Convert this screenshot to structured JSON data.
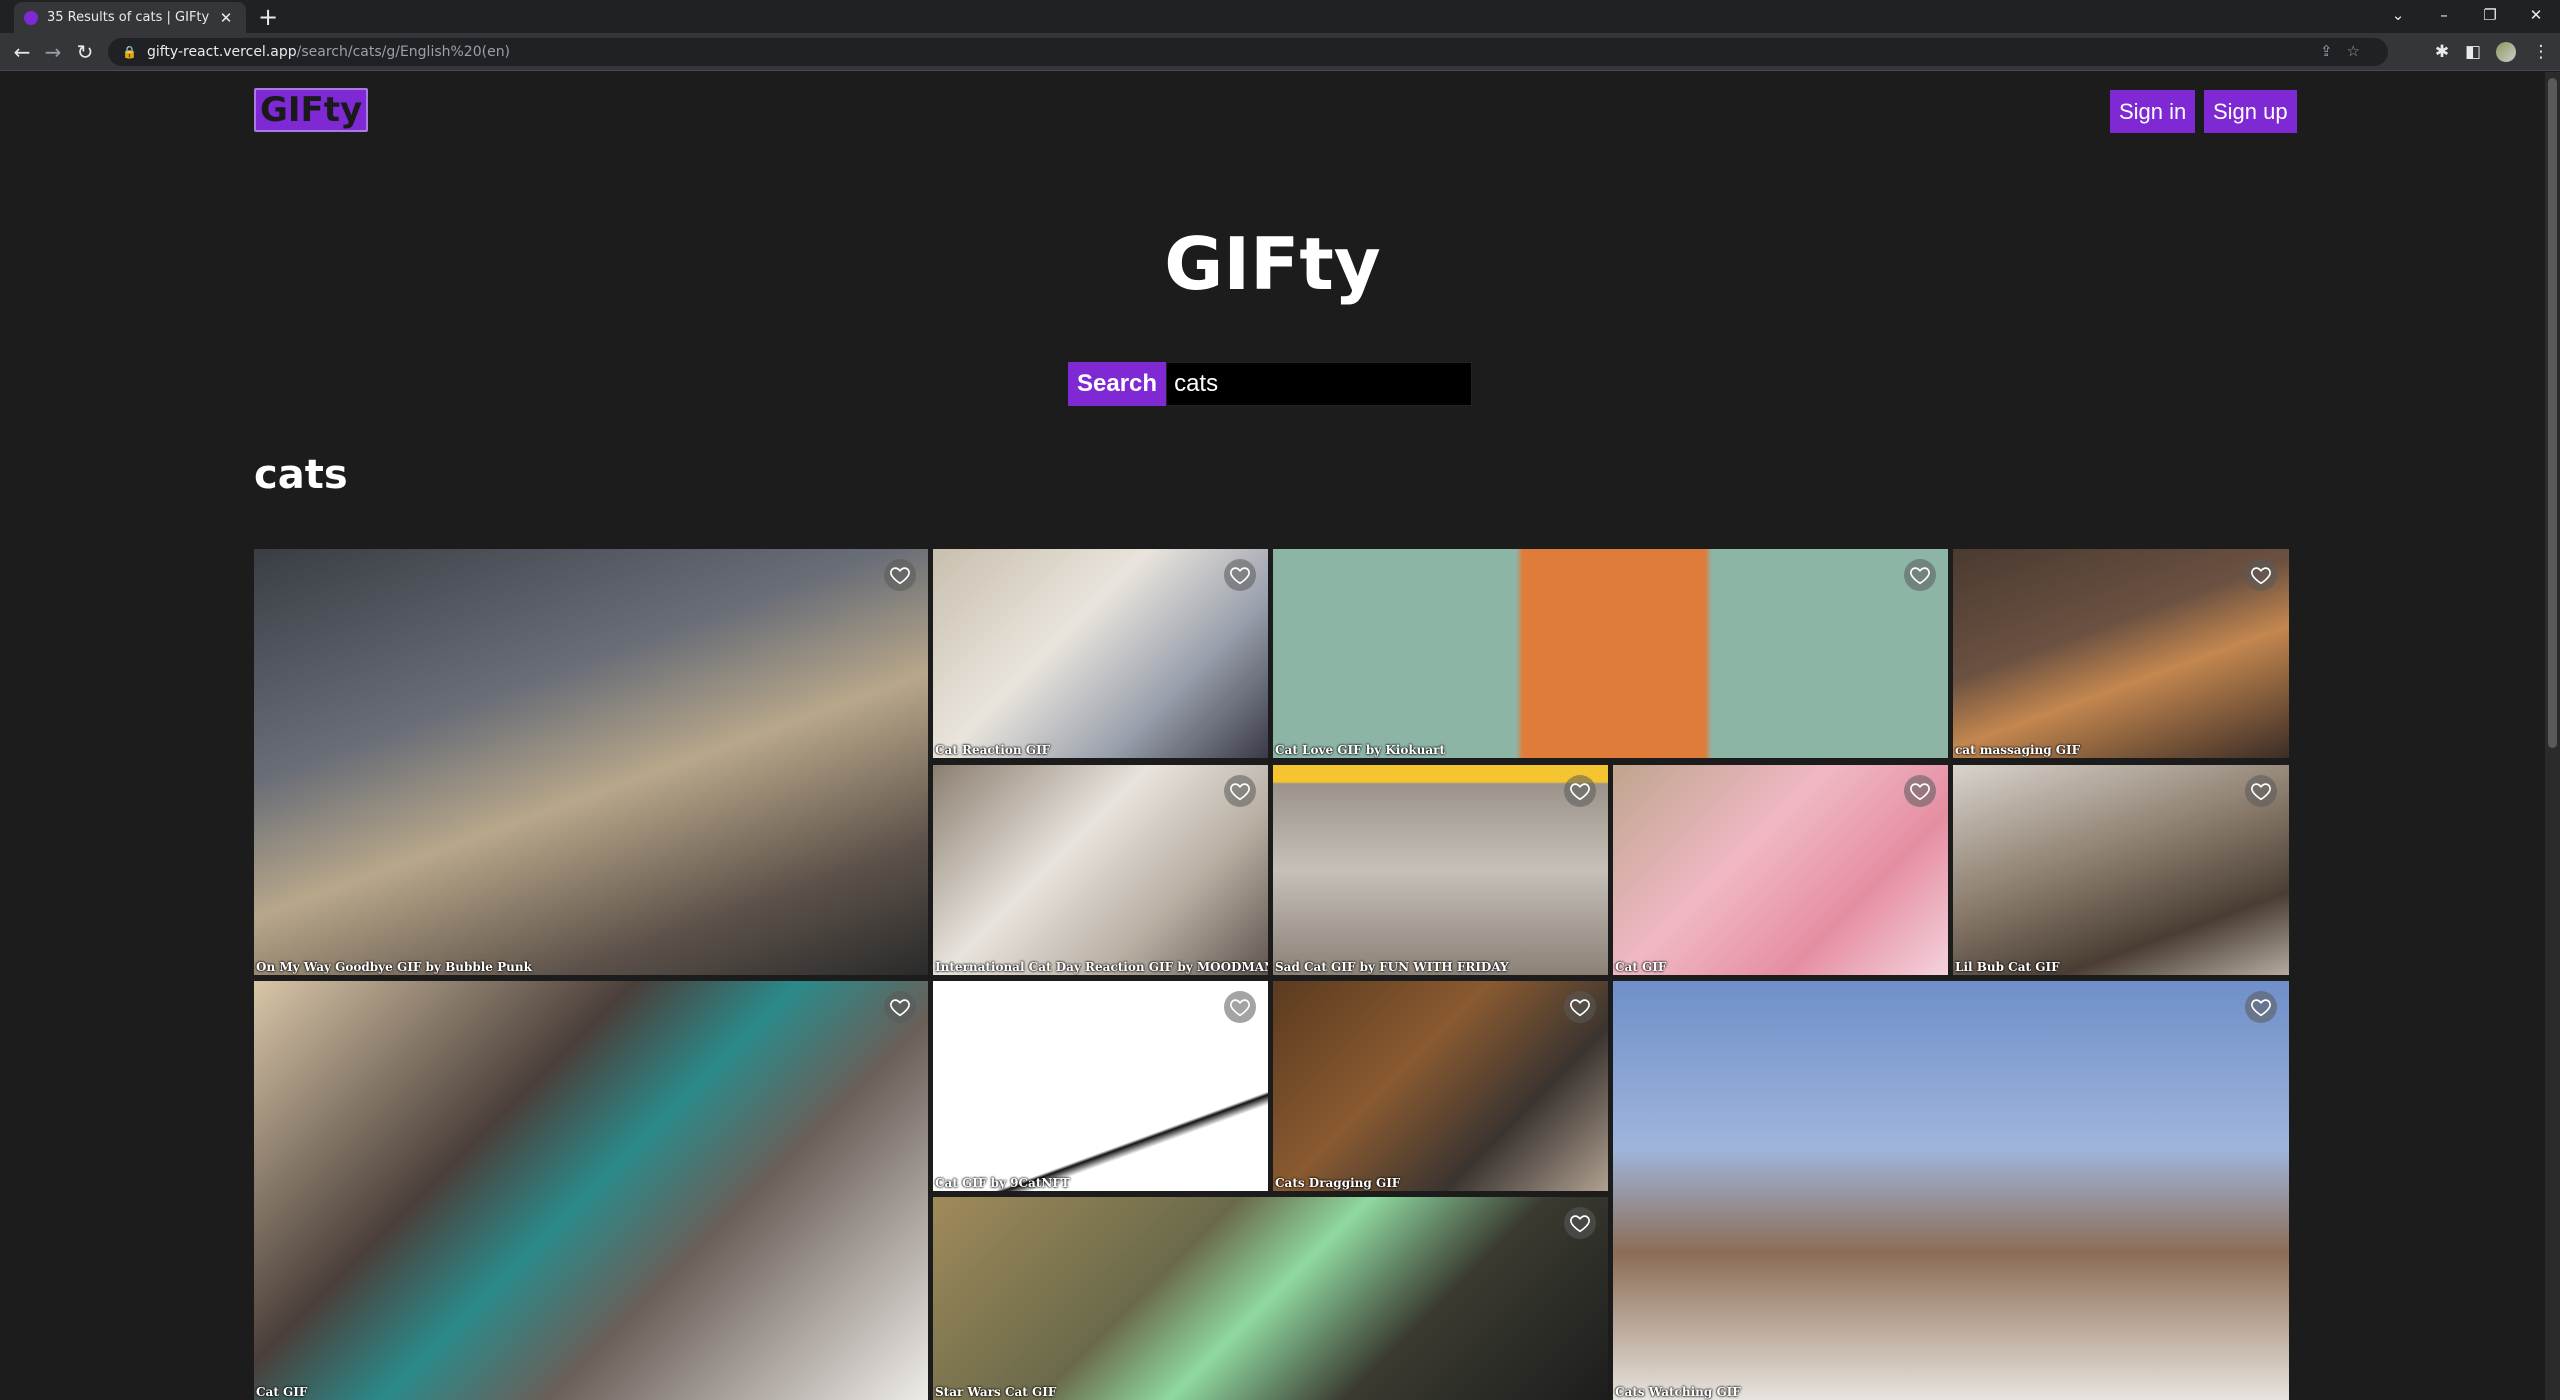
{
  "browser": {
    "tab_title": "35 Results of cats | GIFty",
    "url_host": "gifty-react.vercel.app",
    "url_path": "/search/cats/g/English%20(en)"
  },
  "header": {
    "logo": "GIFty",
    "sign_in": "Sign in",
    "sign_up": "Sign up"
  },
  "hero": {
    "title": "GIFty"
  },
  "search": {
    "button_label": "Search",
    "value": "cats"
  },
  "results": {
    "title": "cats",
    "gifs": [
      {
        "label": "On My Way Goodbye GIF by Bubble Punk",
        "bg": "linear-gradient(160deg,#3a3d44 0%,#6a6e77 35%,#b8a78a 55%,#5d524a 80%,#2a2a2a 100%)"
      },
      {
        "label": "Cat Reaction GIF",
        "bg": "linear-gradient(135deg,#c8bfae 0%,#e9e4dc 40%,#9aa0ad 70%,#3a3a48 100%)"
      },
      {
        "label": "Cat Love GIF by Kiokuart",
        "bg": "linear-gradient(90deg,#8db5a6 0%,#8db5a6 36%,#e07c3a 37%,#e07c3a 64%,#8db5a6 65%,#8db5a6 100%)"
      },
      {
        "label": "cat massaging GIF",
        "bg": "linear-gradient(160deg,#4a3a31 0%,#6b5141 40%,#c4874f 60%,#3b2d26 100%)"
      },
      {
        "label": "International Cat Day Reaction GIF by MOODMAN",
        "bg": "linear-gradient(135deg,#8b7f70 0%,#e8e3dc 40%,#b7aea2 70%,#5e564e 100%)"
      },
      {
        "label": "Sad Cat GIF by FUN WITH FRIDAY",
        "bg": "linear-gradient(180deg,#f4c531 0%,#f4c531 8%,#9b938a 9%,#c6c0b8 50%,#8b8177 100%)"
      },
      {
        "label": "Cat GIF",
        "bg": "linear-gradient(135deg,#bfa58e 0%,#f0b8c4 40%,#e58ea2 70%,#f4d3dc 100%)"
      },
      {
        "label": "Lil Bub Cat GIF",
        "bg": "linear-gradient(160deg,#d9d4cc 0%,#8a7b6c 45%,#4a3e34 75%,#b5aba0 100%)"
      },
      {
        "label": "Cat GIF",
        "bg": "linear-gradient(135deg,#d9c6a8 0%,#4a3f3a 35%,#2b8a8a 50%,#6a5f59 65%,#efece8 100%)"
      },
      {
        "label": "Cat GIF by 9CatNFT",
        "bg": "linear-gradient(160deg,#ffffff 0%,#ffffff 70%,#111 71%,#ffffff 74%)"
      },
      {
        "label": "Cats Dragging GIF",
        "bg": "linear-gradient(135deg,#5b3a1f 0%,#8a5a30 40%,#3a3430 70%,#b0a090 100%)"
      },
      {
        "label": "Cats Watching GIF",
        "bg": "linear-gradient(180deg,#6f8fc9 0%,#9fb5dc 40%,#8c6d55 65%,#e8e4df 100%)"
      },
      {
        "label": "Star Wars Cat GIF",
        "bg": "linear-gradient(135deg,#a08a5a 0%,#6a6a4a 35%,#8fd9a0 50%,#3a3a30 70%,#1d1d1d 100%)"
      }
    ]
  }
}
